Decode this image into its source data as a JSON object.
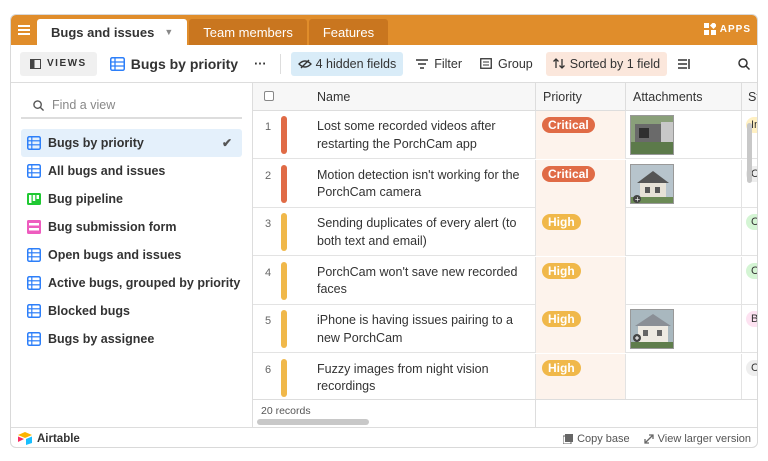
{
  "tabs": [
    {
      "label": "Bugs and issues"
    },
    {
      "label": "Team members"
    },
    {
      "label": "Features"
    }
  ],
  "apps_label": "APPS",
  "toolbar": {
    "views_label": "VIEWS",
    "current_view": "Bugs by priority",
    "more_label": "···",
    "hidden_fields": "4 hidden fields",
    "filter": "Filter",
    "group": "Group",
    "sorted": "Sorted by 1 field"
  },
  "sidebar": {
    "search_placeholder": "Find a view",
    "items": [
      {
        "label": "Bugs by priority",
        "icon": "grid-view-icon",
        "selected": true
      },
      {
        "label": "All bugs and issues",
        "icon": "grid-view-icon"
      },
      {
        "label": "Bug pipeline",
        "icon": "kanban-view-icon"
      },
      {
        "label": "Bug submission form",
        "icon": "form-view-icon"
      },
      {
        "label": "Open bugs and issues",
        "icon": "grid-view-icon"
      },
      {
        "label": "Active bugs, grouped by priority",
        "icon": "grid-view-icon"
      },
      {
        "label": "Blocked bugs",
        "icon": "grid-view-icon"
      },
      {
        "label": "Bugs by assignee",
        "icon": "grid-view-icon"
      }
    ]
  },
  "columns": {
    "name": "Name",
    "priority": "Priority",
    "attachments": "Attachments",
    "status": "Sta"
  },
  "rows": [
    {
      "num": "1",
      "name": "Lost some recorded videos after restarting the PorchCam app",
      "priority": "Critical",
      "status_letter": "In",
      "has_attachment": true
    },
    {
      "num": "2",
      "name": "Motion detection isn't working for the PorchCam camera",
      "priority": "Critical",
      "status_letter": "C",
      "has_attachment": true
    },
    {
      "num": "3",
      "name": "Sending duplicates of every alert (to both text and email)",
      "priority": "High",
      "status_letter": "C",
      "has_attachment": false
    },
    {
      "num": "4",
      "name": "PorchCam won't save new recorded faces",
      "priority": "High",
      "status_letter": "C",
      "has_attachment": false
    },
    {
      "num": "5",
      "name": "iPhone is having issues pairing to a new PorchCam",
      "priority": "High",
      "status_letter": "B",
      "has_attachment": true
    },
    {
      "num": "6",
      "name": "Fuzzy images from night vision recordings",
      "priority": "High",
      "status_letter": "C",
      "has_attachment": false
    }
  ],
  "record_count": "20 records",
  "footer": {
    "brand": "Airtable",
    "copy_base": "Copy base",
    "view_larger": "View larger version"
  },
  "colors": {
    "topbar": "#e08d2b",
    "critical": "#e06b46",
    "high": "#f0b84a",
    "selected_view": "#e4f0fb"
  }
}
